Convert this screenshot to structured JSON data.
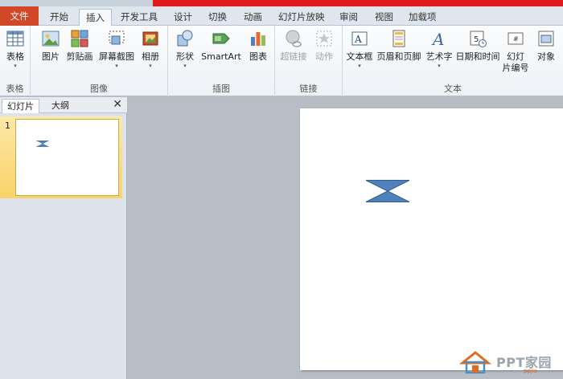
{
  "tabs": [
    {
      "label": "文件"
    },
    {
      "label": "开始"
    },
    {
      "label": "插入"
    },
    {
      "label": "开发工具"
    },
    {
      "label": "设计"
    },
    {
      "label": "切换"
    },
    {
      "label": "动画"
    },
    {
      "label": "幻灯片放映"
    },
    {
      "label": "审阅"
    },
    {
      "label": "视图"
    },
    {
      "label": "加载项"
    }
  ],
  "ribbon": {
    "groups": {
      "tables": "表格",
      "images": "图像",
      "illustrations": "插图",
      "links": "链接",
      "text": "文本"
    },
    "buttons": {
      "table": "表格",
      "picture": "图片",
      "clipart": "剪贴画",
      "screenshot": "屏幕截图",
      "album": "相册",
      "shapes": "形状",
      "smartart": "SmartArt",
      "chart": "图表",
      "hyperlink": "超链接",
      "action": "动作",
      "textbox": "文本框",
      "header_footer": "页眉和页脚",
      "wordart": "艺术字",
      "datetime": "日期和时间",
      "slide_number_1": "幻灯",
      "slide_number_2": "片编号",
      "object": "对象"
    }
  },
  "panel": {
    "tab_slides": "幻灯片",
    "tab_outline": "大纲",
    "close_glyph": "✕",
    "slide_number": "1"
  },
  "watermark": {
    "text": "PPT家园",
    "sub": "ppjia"
  },
  "colors": {
    "file_tab": "#d24726",
    "shape_fill": "#4f81bd",
    "selection": "#f9d36a"
  }
}
